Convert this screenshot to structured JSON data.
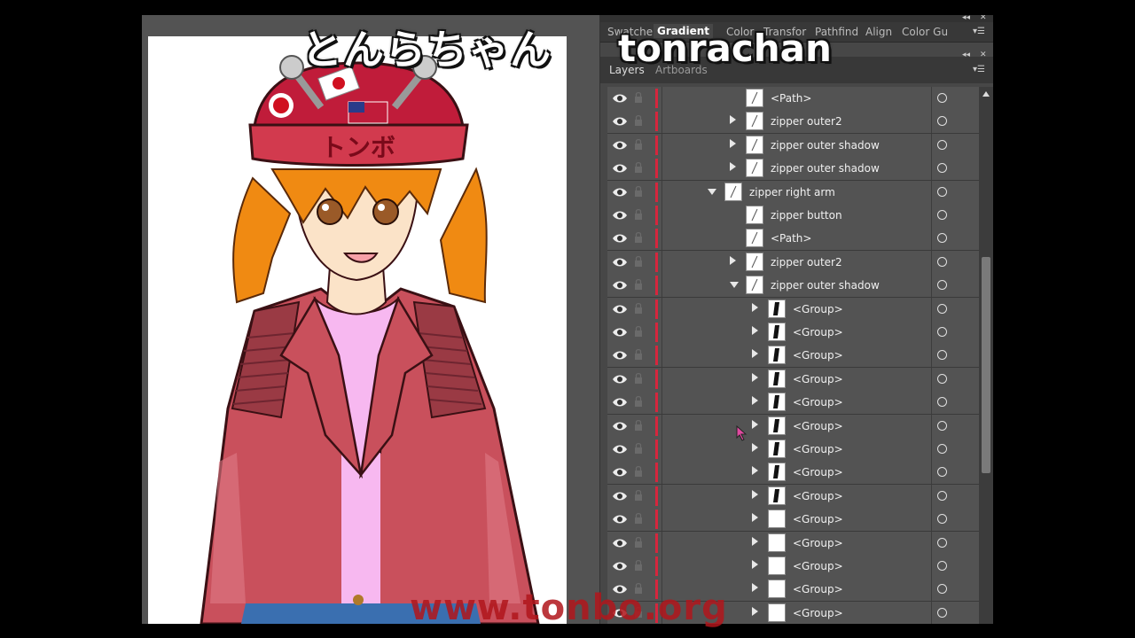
{
  "overlay": {
    "title_jp": "とんらちゃん",
    "title_en": "tonrachan",
    "url": "www.tonbo.org"
  },
  "artwork": {
    "helmet_text": "トンボ"
  },
  "panel_tabs": {
    "items": [
      "Swatche",
      "Gradient",
      "Color",
      "Transfor",
      "Pathfind",
      "Align",
      "Color Gu"
    ],
    "active": "Gradient"
  },
  "layers_panel": {
    "tabs": [
      "Layers",
      "Artboards"
    ],
    "rows": [
      {
        "name": "<Path>",
        "expander": "none",
        "depth": 3
      },
      {
        "name": "zipper outer2",
        "expander": "collapsed",
        "depth": 3
      },
      {
        "name": "zipper outer shadow",
        "expander": "collapsed",
        "depth": 3
      },
      {
        "name": "zipper outer shadow",
        "expander": "collapsed",
        "depth": 3
      },
      {
        "name": "zipper right arm",
        "expander": "expanded",
        "depth": 2
      },
      {
        "name": "zipper button",
        "expander": "none",
        "depth": 3
      },
      {
        "name": "<Path>",
        "expander": "none",
        "depth": 3
      },
      {
        "name": "zipper outer2",
        "expander": "collapsed",
        "depth": 3
      },
      {
        "name": "zipper outer shadow",
        "expander": "expanded",
        "depth": 3
      },
      {
        "name": "<Group>",
        "expander": "collapsed",
        "depth": 4
      },
      {
        "name": "<Group>",
        "expander": "collapsed",
        "depth": 4
      },
      {
        "name": "<Group>",
        "expander": "collapsed",
        "depth": 4
      },
      {
        "name": "<Group>",
        "expander": "collapsed",
        "depth": 4
      },
      {
        "name": "<Group>",
        "expander": "collapsed",
        "depth": 4
      },
      {
        "name": "<Group>",
        "expander": "collapsed",
        "depth": 4
      },
      {
        "name": "<Group>",
        "expander": "collapsed",
        "depth": 4
      },
      {
        "name": "<Group>",
        "expander": "collapsed",
        "depth": 4
      },
      {
        "name": "<Group>",
        "expander": "collapsed",
        "depth": 4
      },
      {
        "name": "<Group>",
        "expander": "collapsed",
        "depth": 4
      },
      {
        "name": "<Group>",
        "expander": "collapsed",
        "depth": 4
      },
      {
        "name": "<Group>",
        "expander": "collapsed",
        "depth": 4
      },
      {
        "name": "<Group>",
        "expander": "collapsed",
        "depth": 4
      },
      {
        "name": "<Group>",
        "expander": "collapsed",
        "depth": 4
      }
    ],
    "layer_color": "#d7263d"
  },
  "colors": {
    "panel_bg": "#535353",
    "jacket": "#c9505c",
    "hair": "#f08a12",
    "url_red": "#b1161c"
  },
  "icons": {
    "visibility": "eye-icon",
    "lock": "lock-icon",
    "target": "target-circle-icon",
    "panel_menu": "panel-menu-icon"
  }
}
